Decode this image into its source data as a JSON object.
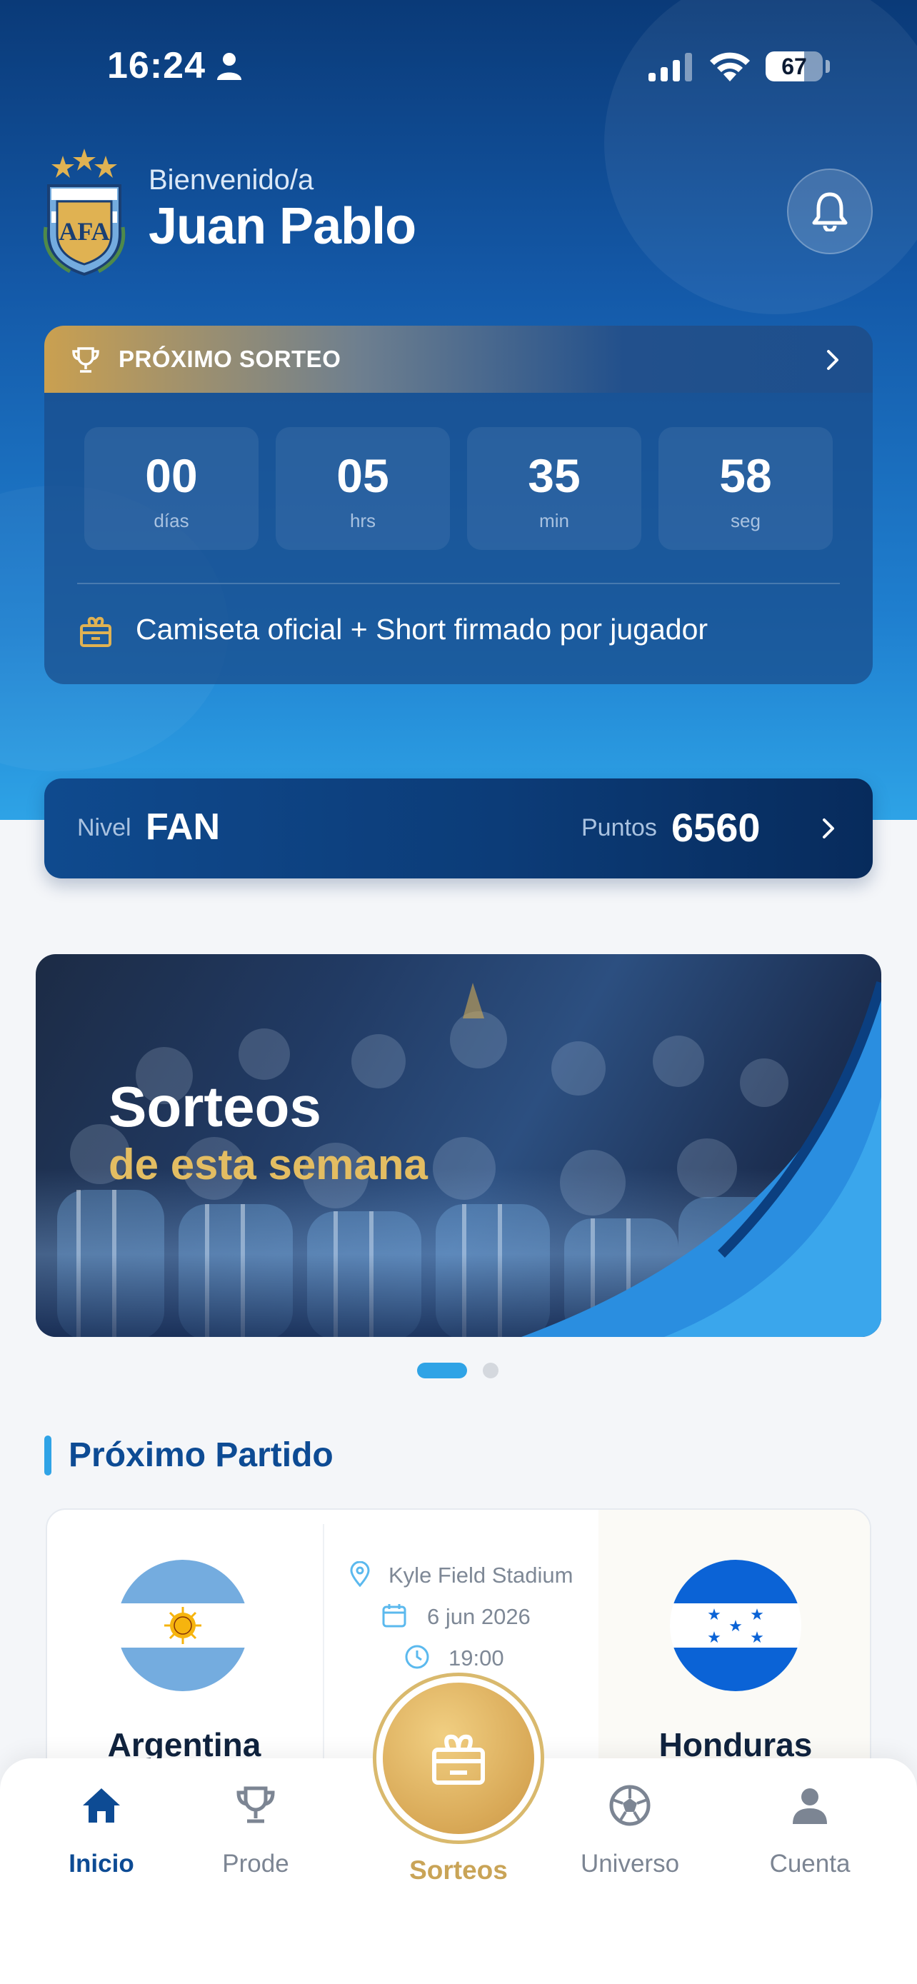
{
  "status_bar": {
    "time": "16:24",
    "battery": "67"
  },
  "header": {
    "welcome": "Bienvenido/a",
    "username": "Juan Pablo"
  },
  "draw": {
    "title": "PRÓXIMO SORTEO",
    "countdown": [
      {
        "value": "00",
        "unit": "días"
      },
      {
        "value": "05",
        "unit": "hrs"
      },
      {
        "value": "35",
        "unit": "min"
      },
      {
        "value": "58",
        "unit": "seg"
      }
    ],
    "prize": "Camiseta oficial + Short firmado por jugador"
  },
  "level": {
    "label": "Nivel",
    "value": "FAN",
    "points_label": "Puntos",
    "points": "6560"
  },
  "banner": {
    "title": "Sorteos",
    "subtitle": "de esta semana",
    "active_slide": 1,
    "slide_count": 2
  },
  "next_match": {
    "section_title": "Próximo Partido",
    "home_team": "Argentina",
    "away_team": "Honduras",
    "venue": "Kyle Field Stadium",
    "date": "6 jun 2026",
    "time": "19:00"
  },
  "nav": {
    "items": [
      {
        "label": "Inicio",
        "icon": "home-icon",
        "active": true
      },
      {
        "label": "Prode",
        "icon": "trophy-icon",
        "active": false
      },
      {
        "label": "Sorteos",
        "icon": "gift-icon",
        "active": false
      },
      {
        "label": "Universo",
        "icon": "soccer-ball-icon",
        "active": false
      },
      {
        "label": "Cuenta",
        "icon": "user-icon",
        "active": false
      }
    ]
  },
  "colors": {
    "brand_blue": "#0d4b94",
    "accent_sky": "#2fa3e6",
    "gold": "#d8a856"
  }
}
